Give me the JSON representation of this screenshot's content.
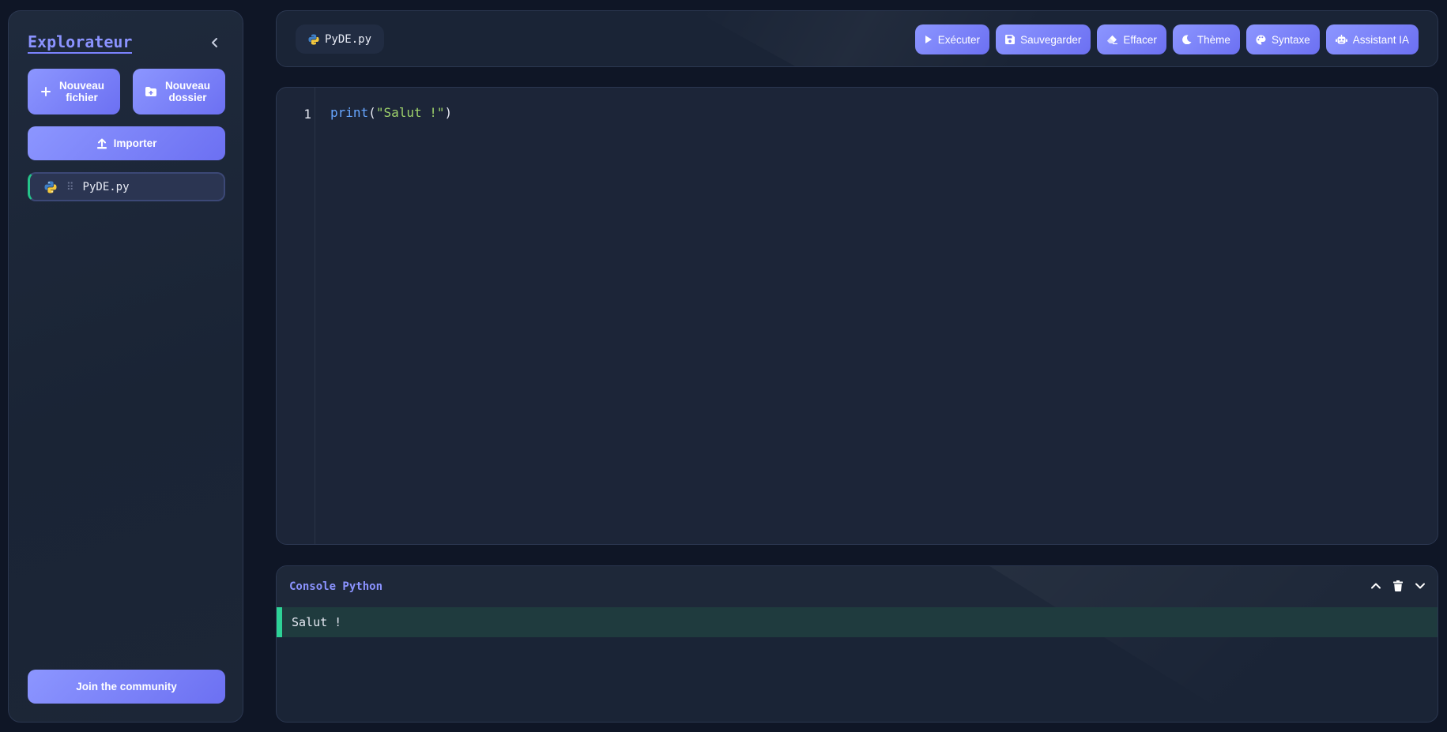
{
  "sidebar": {
    "title": "Explorateur",
    "new_file_label": "Nouveau fichier",
    "new_folder_label": "Nouveau dossier",
    "import_label": "Importer",
    "files": [
      {
        "name": "PyDE.py",
        "icon": "python-icon",
        "active": true
      }
    ],
    "community_label": "Join the community"
  },
  "tabs": [
    {
      "name": "PyDE.py",
      "icon": "python-icon"
    }
  ],
  "toolbar": {
    "run_label": "Exécuter",
    "save_label": "Sauvegarder",
    "clear_label": "Effacer",
    "theme_label": "Thème",
    "syntax_label": "Syntaxe",
    "assistant_label": "Assistant IA"
  },
  "editor": {
    "lines": [
      {
        "number": "1",
        "fn": "print",
        "open": "(",
        "str": "\"Salut !\"",
        "close": ")"
      }
    ]
  },
  "console": {
    "title": "Console Python",
    "output": [
      "Salut !"
    ]
  },
  "colors": {
    "accent": "#7b83ff",
    "success": "#2dd296",
    "background": "#0f1626",
    "panel": "#1a2436"
  }
}
